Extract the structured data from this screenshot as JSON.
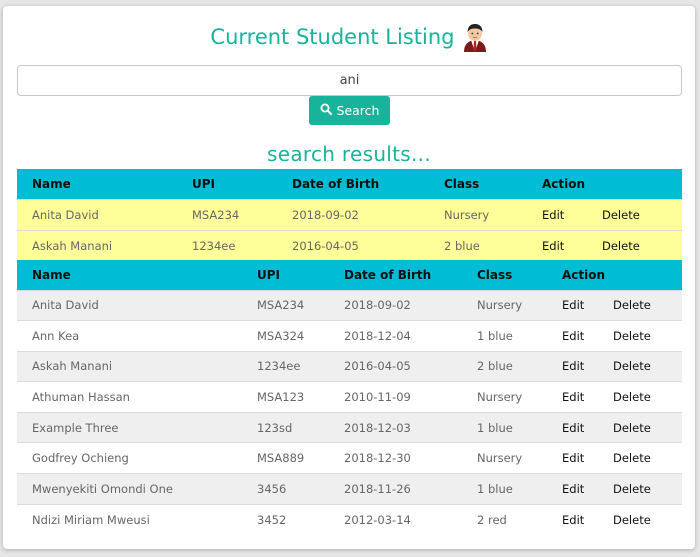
{
  "page": {
    "title": "Current Student Listing",
    "title_icon": "student-avatar-icon"
  },
  "search": {
    "value": "ani",
    "button_label": "Search",
    "button_icon": "search-icon"
  },
  "results": {
    "heading": "search results...",
    "columns": [
      "Name",
      "UPI",
      "Date of Birth",
      "Class",
      "Action"
    ],
    "rows": [
      {
        "name": "Anita David",
        "upi": "MSA234",
        "dob": "2018-09-02",
        "class": "Nursery",
        "edit": "Edit",
        "delete": "Delete"
      },
      {
        "name": "Askah Manani",
        "upi": "1234ee",
        "dob": "2016-04-05",
        "class": "2 blue",
        "edit": "Edit",
        "delete": "Delete"
      }
    ]
  },
  "all_students": {
    "columns": [
      "Name",
      "UPI",
      "Date of Birth",
      "Class",
      "Action"
    ],
    "rows": [
      {
        "name": "Anita David",
        "upi": "MSA234",
        "dob": "2018-09-02",
        "class": "Nursery",
        "edit": "Edit",
        "delete": "Delete"
      },
      {
        "name": "Ann Kea",
        "upi": "MSA324",
        "dob": "2018-12-04",
        "class": "1 blue",
        "edit": "Edit",
        "delete": "Delete"
      },
      {
        "name": "Askah Manani",
        "upi": "1234ee",
        "dob": "2016-04-05",
        "class": "2 blue",
        "edit": "Edit",
        "delete": "Delete"
      },
      {
        "name": "Athuman Hassan",
        "upi": "MSA123",
        "dob": "2010-11-09",
        "class": "Nursery",
        "edit": "Edit",
        "delete": "Delete"
      },
      {
        "name": "Example Three",
        "upi": "123sd",
        "dob": "2018-12-03",
        "class": "1 blue",
        "edit": "Edit",
        "delete": "Delete"
      },
      {
        "name": "Godfrey Ochieng",
        "upi": "MSA889",
        "dob": "2018-12-30",
        "class": "Nursery",
        "edit": "Edit",
        "delete": "Delete"
      },
      {
        "name": "Mwenyekiti Omondi One",
        "upi": "3456",
        "dob": "2018-11-26",
        "class": "1 blue",
        "edit": "Edit",
        "delete": "Delete"
      },
      {
        "name": "Ndizi Miriam Mweusi",
        "upi": "3452",
        "dob": "2012-03-14",
        "class": "2 red",
        "edit": "Edit",
        "delete": "Delete"
      }
    ]
  },
  "colors": {
    "accent": "#17b39b",
    "table_header": "#00bcd4",
    "highlight_row": "#ffff99"
  }
}
